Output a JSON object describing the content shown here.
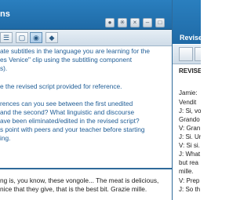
{
  "left_panel": {
    "title": "ns",
    "instructions": [
      "ate subtitles in the language you are learning for the",
      "es Venice\" clip using the subtitling component",
      "s).",
      "",
      "e the revised script provided for reference.",
      "",
      "rences can you see between the first unedited",
      "and the second? What linguistic and discourse",
      "ave been eliminated/edited in the revised script?",
      "s point with peers and your teacher before starting",
      "ing."
    ],
    "script_lines": [
      "ng is, you know, these vongole... The meat is delicious,",
      "nice that they give, that is the best bit. Grazie mille."
    ]
  },
  "right_panel": {
    "title": "Revise",
    "heading": "REVISE",
    "lines": [
      "Jamie:",
      "Vendit",
      "J: Si, vo",
      "Grando",
      "V: Gran",
      "J: Si. Ur",
      "V: Si si.",
      "J: What",
      "but rea",
      "mille.",
      "V: Prep",
      "J: So th"
    ]
  }
}
